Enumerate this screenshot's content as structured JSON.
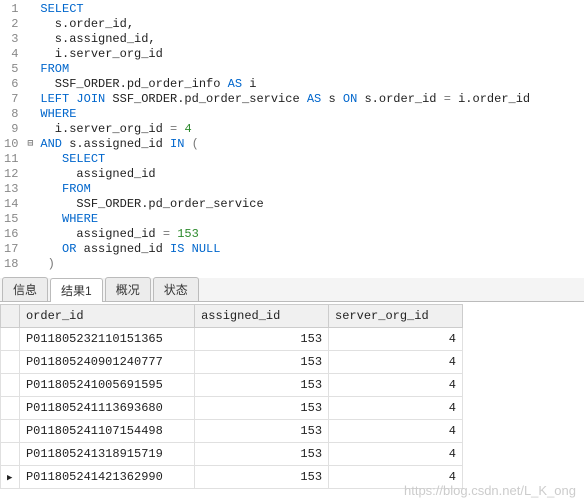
{
  "editor": {
    "lines": [
      {
        "n": 1,
        "fold": "",
        "html": "<span class='kw'>SELECT</span>"
      },
      {
        "n": 2,
        "fold": "",
        "html": "  s.order_id,"
      },
      {
        "n": 3,
        "fold": "",
        "html": "  s.assigned_id,"
      },
      {
        "n": 4,
        "fold": "",
        "html": "  i.server_org_id"
      },
      {
        "n": 5,
        "fold": "",
        "html": "<span class='kw'>FROM</span>"
      },
      {
        "n": 6,
        "fold": "",
        "html": "  SSF_ORDER.pd_order_info <span class='kw'>AS</span> i"
      },
      {
        "n": 7,
        "fold": "",
        "html": "<span class='kw'>LEFT JOIN</span> SSF_ORDER.pd_order_service <span class='kw'>AS</span> s <span class='kw'>ON</span> s.order_id <span class='op'>=</span> i.order_id"
      },
      {
        "n": 8,
        "fold": "",
        "html": "<span class='kw'>WHERE</span>"
      },
      {
        "n": 9,
        "fold": "",
        "html": "  i.server_org_id <span class='op'>=</span> <span class='num'>4</span>"
      },
      {
        "n": 10,
        "fold": "⊟",
        "html": "<span class='kw'>AND</span> s.assigned_id <span class='kw'>IN</span> <span class='op'>(</span>"
      },
      {
        "n": 11,
        "fold": "",
        "html": "   <span class='kw'>SELECT</span>"
      },
      {
        "n": 12,
        "fold": "",
        "html": "     assigned_id"
      },
      {
        "n": 13,
        "fold": "",
        "html": "   <span class='kw'>FROM</span>"
      },
      {
        "n": 14,
        "fold": "",
        "html": "     SSF_ORDER.pd_order_service"
      },
      {
        "n": 15,
        "fold": "",
        "html": "   <span class='kw'>WHERE</span>"
      },
      {
        "n": 16,
        "fold": "",
        "html": "     assigned_id <span class='op'>=</span> <span class='num'>153</span>"
      },
      {
        "n": 17,
        "fold": "",
        "html": "   <span class='kw'>OR</span> assigned_id <span class='kw'>IS NULL</span>"
      },
      {
        "n": 18,
        "fold": "",
        "html": " <span class='op'>)</span>"
      }
    ]
  },
  "tabs": {
    "items": [
      "信息",
      "结果1",
      "概况",
      "状态"
    ],
    "active": 1
  },
  "grid": {
    "headers": [
      "order_id",
      "assigned_id",
      "server_org_id"
    ],
    "rows": [
      {
        "order_id": "P011805232110151365",
        "assigned_id": 153,
        "server_org_id": 4,
        "current": false
      },
      {
        "order_id": "P011805240901240777",
        "assigned_id": 153,
        "server_org_id": 4,
        "current": false
      },
      {
        "order_id": "P011805241005691595",
        "assigned_id": 153,
        "server_org_id": 4,
        "current": false
      },
      {
        "order_id": "P011805241113693680",
        "assigned_id": 153,
        "server_org_id": 4,
        "current": false
      },
      {
        "order_id": "P011805241107154498",
        "assigned_id": 153,
        "server_org_id": 4,
        "current": false
      },
      {
        "order_id": "P011805241318915719",
        "assigned_id": 153,
        "server_org_id": 4,
        "current": false
      },
      {
        "order_id": "P011805241421362990",
        "assigned_id": 153,
        "server_org_id": 4,
        "current": true
      }
    ]
  },
  "watermark": "https://blog.csdn.net/L_K_ong"
}
